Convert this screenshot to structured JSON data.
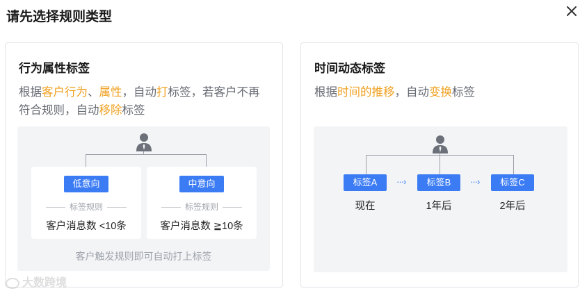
{
  "dialog": {
    "title": "请先选择规则类型"
  },
  "icons": {
    "close": "close-icon",
    "person": "person-icon",
    "arrow": "dotted-arrow-icon"
  },
  "colors": {
    "accent_blue": "#3b7cf5",
    "highlight_orange": "#f0a020",
    "muted_text": "#666a72"
  },
  "behavior_card": {
    "title": "行为属性标签",
    "desc": {
      "p1": "根据",
      "h1": "客户行为",
      "p2": "、",
      "h2": "属性",
      "p3": "，自动",
      "h3": "打",
      "p4": "标签，若客户不再符合规则，自动",
      "h4": "移除",
      "p5": "标签"
    },
    "sub_cards": [
      {
        "tag": "低意向",
        "rule_label": "标签规则",
        "rule_value": "客户消息数 <10条"
      },
      {
        "tag": "中意向",
        "rule_label": "标签规则",
        "rule_value": "客户消息数 ≧10条"
      }
    ],
    "footnote": "客户触发规则即可自动打上标签"
  },
  "time_card": {
    "title": "时间动态标签",
    "desc": {
      "p1": "根据",
      "h1": "时间的推移",
      "p2": "，自动",
      "h2": "变换",
      "p3": "标签"
    },
    "tags": [
      {
        "label": "标签A",
        "time": "现在"
      },
      {
        "label": "标签B",
        "time": "1年后"
      },
      {
        "label": "标签C",
        "time": "2年后"
      }
    ],
    "arrow_text": "···›"
  },
  "watermark": {
    "text": "大数跨境"
  }
}
